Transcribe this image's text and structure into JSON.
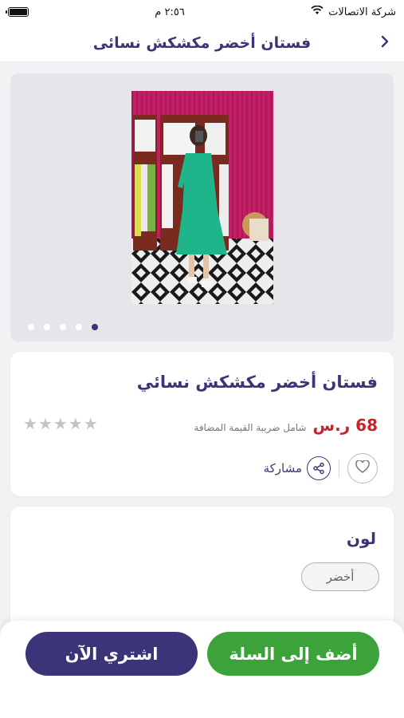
{
  "status_bar": {
    "carrier": "شركة الاتصالات",
    "time": "٢:٥٦ م"
  },
  "header": {
    "title": "فستان أخضر مكشكش نسائى",
    "back_icon": "chevron-right-icon"
  },
  "gallery": {
    "image_count": 5,
    "active_index": 0
  },
  "product": {
    "name": "فستان أخضر مكشكش نسائي",
    "price": "68 ر.س",
    "vat_note": "شامل ضريبة القيمة المضافة",
    "rating": 0,
    "max_rating": 5,
    "share_label": "مشاركة",
    "colors": {
      "price": "#c8232c",
      "primary": "#3b3478",
      "cart": "#3ca33a"
    }
  },
  "options": {
    "color_title": "لون",
    "selected_color": "أخضر"
  },
  "bottom_bar": {
    "add_to_cart": "أضف إلى السلة",
    "buy_now": "اشتري الآن"
  }
}
